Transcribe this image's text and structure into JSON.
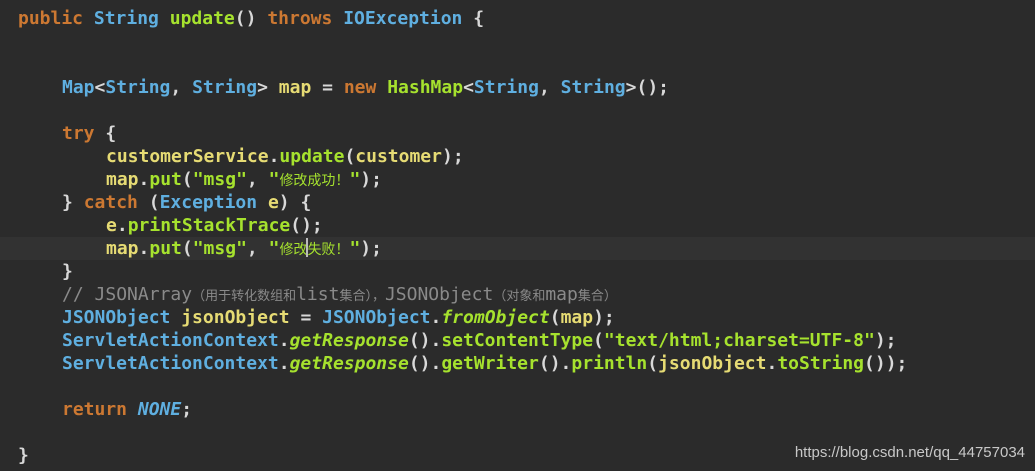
{
  "theme": {
    "background": "#2b2b2b",
    "current_line_background": "#323232",
    "keyword_color": "#cc7832",
    "type_color": "#5fafe0",
    "method_color": "#a6e22e",
    "variable_color": "#e6db74",
    "comment_color": "#8a8a8a"
  },
  "code": {
    "l1": {
      "kw_public": "public",
      "type_string": "String",
      "fn_update": "update",
      "parens": "()",
      "kw_throws": "throws",
      "type_ioexception": "IOException",
      "brace": "{"
    },
    "l2": {
      "type_map": "Map",
      "lt": "<",
      "t1": "String",
      "comma": ",",
      "t2": "String",
      "gt": ">",
      "var_map": "map",
      "eq": "=",
      "kw_new": "new",
      "fn_hashmap": "HashMap",
      "lt2": "<",
      "t3": "String",
      "comma2": ",",
      "t4": "String",
      "gt2": ">",
      "end": "();"
    },
    "l3": {
      "kw_try": "try",
      "brace": "{"
    },
    "l4": {
      "var_cs": "customerService",
      "dot": ".",
      "fn_update": "update",
      "open": "(",
      "var_customer": "customer",
      "close": ");"
    },
    "l5": {
      "var_map": "map",
      "dot": ".",
      "fn_put": "put",
      "open": "(",
      "str_msg": "\"msg\"",
      "comma": ",",
      "q1": "\"",
      "zh": "修改成功！",
      "q2": "\"",
      "close": ");"
    },
    "l6": {
      "brace": "}",
      "kw_catch": "catch",
      "open": "(",
      "type_exception": "Exception",
      "var_e": "e",
      "close": ")",
      "brace2": "{"
    },
    "l7": {
      "var_e": "e",
      "dot": ".",
      "fn_pst": "printStackTrace",
      "end": "();"
    },
    "l8": {
      "var_map": "map",
      "dot": ".",
      "fn_put": "put",
      "open": "(",
      "str_msg": "\"msg\"",
      "comma": ",",
      "q1": "\"",
      "zh_a": "修改",
      "zh_b": "失败！",
      "q2": "\"",
      "close": ");"
    },
    "l9": {
      "brace": "}"
    },
    "l10": {
      "slashes": "//",
      "a": " JSONArray",
      "b": "（用于转化数组和",
      "c": "list",
      "d": "集合），",
      "e": "JSONObject",
      "f": "（对象和",
      "g": "map",
      "h": "集合）"
    },
    "l11": {
      "type_jo": "JSONObject",
      "var_jo": "jsonObject",
      "eq": "=",
      "type_jo2": "JSONObject",
      "dot": ".",
      "fn_fo": "fromObject",
      "open": "(",
      "var_map": "map",
      "close": ");"
    },
    "l12": {
      "type_sac": "ServletActionContext",
      "dot": ".",
      "fn_gr": "getResponse",
      "p": "().",
      "fn_sct": "setContentType",
      "open": "(",
      "str": "\"text/html;charset=UTF-8\"",
      "close": ");"
    },
    "l13": {
      "type_sac": "ServletActionContext",
      "dot": ".",
      "fn_gr": "getResponse",
      "p": "().",
      "fn_gw": "getWriter",
      "p2": "().",
      "fn_pl": "println",
      "open": "(",
      "var_jo": "jsonObject",
      "dot2": ".",
      "fn_ts": "toString",
      "close": "());"
    },
    "l14": {
      "kw_return": "return",
      "cn_none": "NONE",
      "semi": ";"
    },
    "l15": {
      "brace": "}"
    }
  },
  "watermark": "https://blog.csdn.net/qq_44757034"
}
